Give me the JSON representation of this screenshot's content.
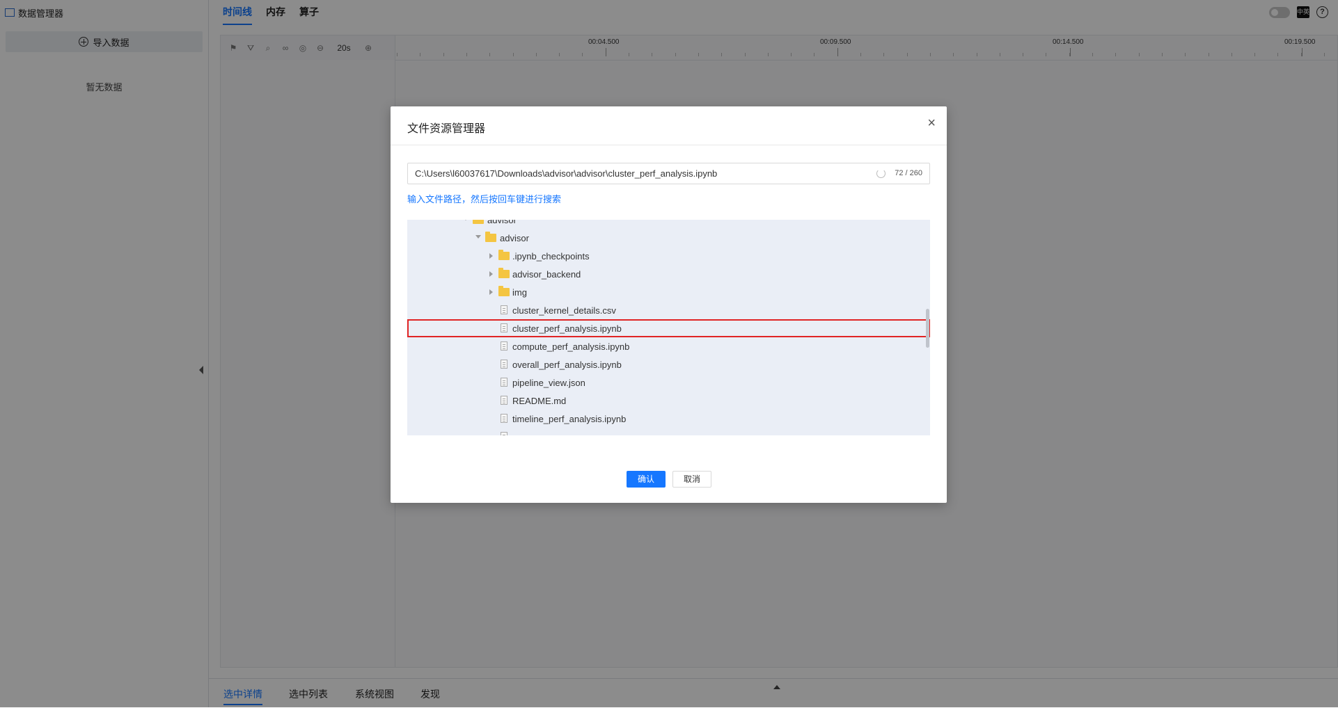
{
  "left_panel": {
    "title": "数据管理器",
    "import_label": "导入数据",
    "empty_text": "暂无数据"
  },
  "top_tabs": [
    "时间线",
    "内存",
    "算子"
  ],
  "top_right": {
    "lang_label": "中英"
  },
  "timeline": {
    "duration": "20s",
    "ruler_labels": [
      "00:04.500",
      "00:09.500",
      "00:14.500",
      "00:19.500"
    ]
  },
  "bottom_tabs": [
    "选中详情",
    "选中列表",
    "系统视图",
    "发现"
  ],
  "dialog": {
    "title": "文件资源管理器",
    "path_value": "C:\\Users\\l60037617\\Downloads\\advisor\\advisor\\cluster_perf_analysis.ipynb",
    "char_count": "72 / 260",
    "hint": "输入文件路径，然后按回车键进行搜索",
    "tree": [
      {
        "label": "advisor",
        "type": "folder",
        "expanded": true
      },
      {
        "label": ".ipynb_checkpoints",
        "type": "folder",
        "expanded": false
      },
      {
        "label": "advisor_backend",
        "type": "folder",
        "expanded": false
      },
      {
        "label": "img",
        "type": "folder",
        "expanded": false
      },
      {
        "label": "cluster_kernel_details.csv",
        "type": "file"
      },
      {
        "label": "cluster_perf_analysis.ipynb",
        "type": "file",
        "selected": true
      },
      {
        "label": "compute_perf_analysis.ipynb",
        "type": "file"
      },
      {
        "label": "overall_perf_analysis.ipynb",
        "type": "file"
      },
      {
        "label": "pipeline_view.json",
        "type": "file"
      },
      {
        "label": "README.md",
        "type": "file"
      },
      {
        "label": "timeline_perf_analysis.ipynb",
        "type": "file"
      }
    ],
    "ok_label": "确认",
    "cancel_label": "取消",
    "close_symbol": "×"
  },
  "colors": {
    "accent": "#1677ff",
    "selection_outline": "#e02424",
    "folder": "#f4c542",
    "tree_background": "#eaeef6"
  }
}
